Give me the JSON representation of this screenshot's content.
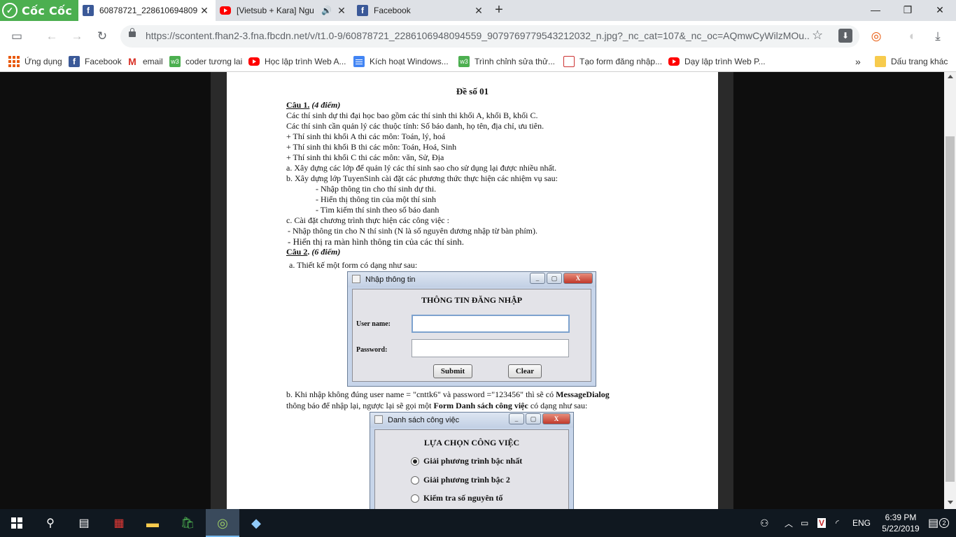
{
  "browser": {
    "brand": "Cốc Cốc",
    "tabs": [
      {
        "title": "60878721_228610694809",
        "icon": "facebook-icon",
        "active": true
      },
      {
        "title": "[Vietsub + Kara] Ngu",
        "icon": "youtube-icon",
        "active": false
      },
      {
        "title": "Facebook",
        "icon": "facebook-icon",
        "active": false
      }
    ],
    "window_controls": {
      "minimize": "—",
      "maximize": "❐",
      "close": "✕"
    },
    "url": "https://scontent.fhan2-3.fna.fbcdn.net/v/t1.0-9/60878721_2286106948094559_9079769779543212032_n.jpg?_nc_cat=107&_nc_oc=AQmwCyWilzMOu...",
    "bookmarks": [
      {
        "label": "Ứng dụng",
        "icon": "apps-icon"
      },
      {
        "label": "Facebook",
        "icon": "facebook-icon"
      },
      {
        "label": "email",
        "icon": "gmail-icon"
      },
      {
        "label": "coder tương lai",
        "icon": "w3schools-icon"
      },
      {
        "label": "Học lập trình Web A...",
        "icon": "youtube-icon"
      },
      {
        "label": "Kích hoạt Windows...",
        "icon": "docs-icon"
      },
      {
        "label": "Trình chỉnh sửa thử...",
        "icon": "w3schools-icon"
      },
      {
        "label": "Tạo form đăng nhập...",
        "icon": "site-icon"
      },
      {
        "label": "Dạy lập trình Web P...",
        "icon": "youtube-icon"
      }
    ],
    "bookmarks_overflow": "»",
    "other_bookmarks": "Dấu trang khác"
  },
  "document": {
    "title": "Đề số 01",
    "q1_label": "Câu 1.",
    "q1_points": "(4 điểm)",
    "lines": [
      "Các thí sinh dự thi đại học bao gồm các thí sinh thi khối A, khối B, khối C.",
      "Các thí sinh cần quản lý các thuộc tính: Số báo danh, họ tên, địa chỉ, ưu tiên.",
      "+ Thí sinh thi khối A thi các môn: Toán, lý, hoá",
      "+ Thí sinh thi khối B thi các môn: Toán, Hoá, Sinh",
      "+ Thí sinh thi khối C thi các môn: văn, Sử, Địa",
      "a. Xây dựng các lớp để quản lý các thí sinh sao cho sử dụng lại được nhiều nhất.",
      "b. Xây dựng lớp TuyenSinh cài đặt các phương thức thực hiện các nhiệm vụ sau:",
      "- Nhập thông tin cho thí sinh dự thi.",
      "- Hiển thị thông tin của một thí sinh",
      "- Tìm kiếm thí sinh theo số báo danh",
      "c. Cài đặt chương trình thực hiện các công việc :",
      "- Nhập thông tin cho N thí sinh (N là số nguyên dương nhập từ bàn phím).",
      "- Hiển thị ra màn hình thông tin của các thí sinh."
    ],
    "q2_label": "Câu 2",
    "q2_points": "(6 điểm)",
    "q2_a": "a.  Thiết kế một form có dạng như sau:",
    "q2_b_1": "b. Khi nhập không đúng user name = \"cnttk6\" và password =\"123456\"  thì sẽ có",
    "q2_b_1_bold": "MessageDialog",
    "q2_b_2": "thông báo để nhập lại,  ngược lại sẽ gọi một",
    "q2_b_2_bold": "Form Danh sách công việc",
    "q2_b_2_end": "có dạng như sau:"
  },
  "login_form": {
    "window_title": "Nhập thông tin",
    "heading": "THÔNG TIN ĐĂNG NHẬP",
    "username_label": "User name:",
    "password_label": "Password:",
    "username_value": "",
    "password_value": "",
    "submit_label": "Submit",
    "clear_label": "Clear"
  },
  "tasks_form": {
    "window_title": "Danh sách công việc",
    "heading": "LỰA CHỌN CÔNG VIỆC",
    "options": [
      {
        "label": "Giải phương trình bậc nhất",
        "selected": true
      },
      {
        "label": "Giải phương trình bậc 2",
        "selected": false
      },
      {
        "label": "Kiểm tra số nguyên tố",
        "selected": false
      }
    ]
  },
  "taskbar": {
    "language": "ENG",
    "time": "6:39 PM",
    "date": "5/22/2019",
    "notification_count": "2"
  }
}
